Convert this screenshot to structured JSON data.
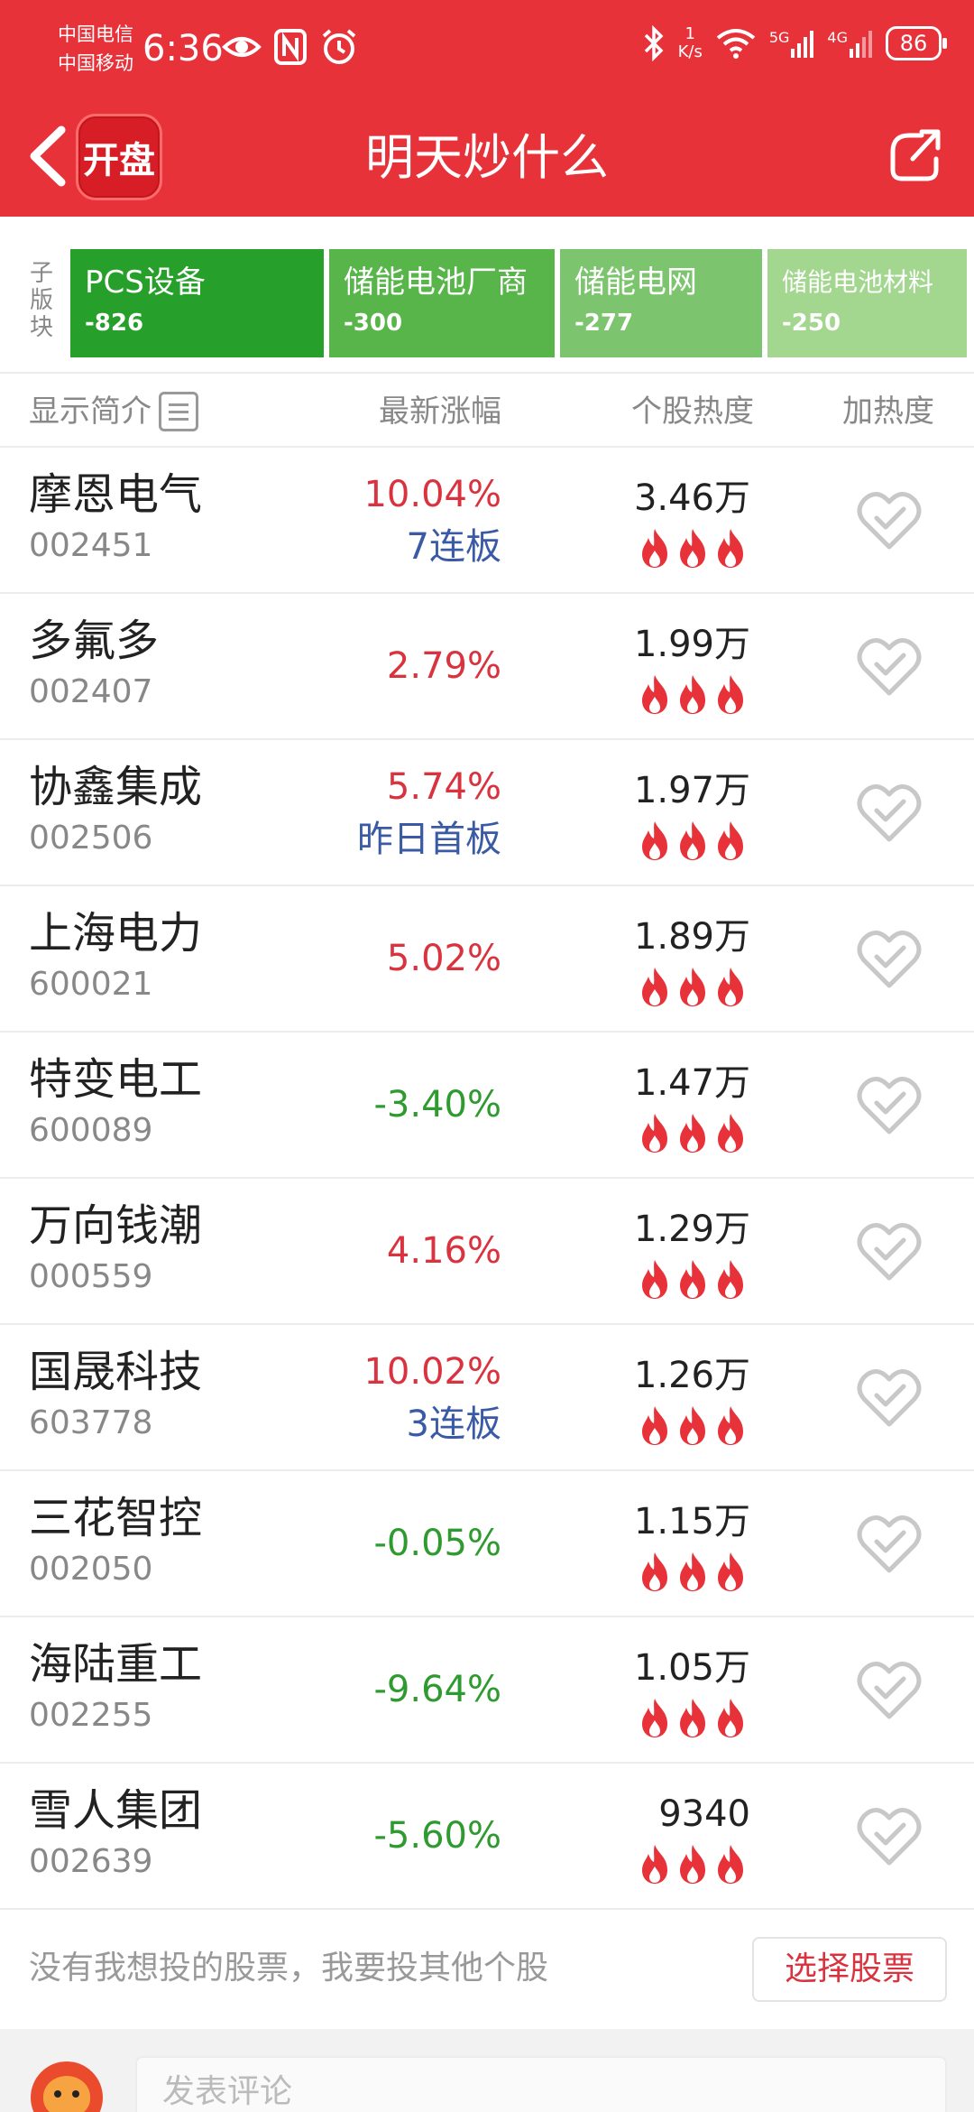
{
  "status_bar": {
    "carrier1": "中国电信",
    "carrier2": "中国移动",
    "time": "6:36",
    "net_speed_value": "1",
    "net_speed_unit": "K/s",
    "signal1_label": "5G",
    "signal2_label": "4G",
    "battery": "86",
    "icons_left": [
      "eye-icon",
      "nfc-icon",
      "alarm-icon"
    ],
    "icons_right": [
      "bluetooth-icon",
      "wifi-icon",
      "signal-icon",
      "signal-icon",
      "battery-icon"
    ]
  },
  "header": {
    "title": "明天炒什么",
    "logo_text": "开盘",
    "background_color": "#e8323a"
  },
  "sectors": {
    "label": "子版块",
    "tabs": [
      {
        "name": "PCS设备",
        "value": "-826",
        "color": "#26a02a"
      },
      {
        "name": "储能电池厂商",
        "value": "-300",
        "color": "#57b54a"
      },
      {
        "name": "储能电网",
        "value": "-277",
        "color": "#7cc46d"
      },
      {
        "name": "储能电池材料",
        "value": "-250",
        "color": "#a3d68f"
      }
    ]
  },
  "columns": {
    "intro": "显示简介",
    "change": "最新涨幅",
    "heat": "个股热度",
    "add": "加热度"
  },
  "stocks": [
    {
      "name": "摩恩电气",
      "code": "002451",
      "change": "10.04%",
      "dir": "up",
      "note": "7连板",
      "heat": "3.46万"
    },
    {
      "name": "多氟多",
      "code": "002407",
      "change": "2.79%",
      "dir": "up",
      "note": "",
      "heat": "1.99万"
    },
    {
      "name": "协鑫集成",
      "code": "002506",
      "change": "5.74%",
      "dir": "up",
      "note": "昨日首板",
      "heat": "1.97万"
    },
    {
      "name": "上海电力",
      "code": "600021",
      "change": "5.02%",
      "dir": "up",
      "note": "",
      "heat": "1.89万"
    },
    {
      "name": "特变电工",
      "code": "600089",
      "change": "-3.40%",
      "dir": "down",
      "note": "",
      "heat": "1.47万"
    },
    {
      "name": "万向钱潮",
      "code": "000559",
      "change": "4.16%",
      "dir": "up",
      "note": "",
      "heat": "1.29万"
    },
    {
      "name": "国晟科技",
      "code": "603778",
      "change": "10.02%",
      "dir": "up",
      "note": "3连板",
      "heat": "1.26万"
    },
    {
      "name": "三花智控",
      "code": "002050",
      "change": "-0.05%",
      "dir": "down",
      "note": "",
      "heat": "1.15万"
    },
    {
      "name": "海陆重工",
      "code": "002255",
      "change": "-9.64%",
      "dir": "down",
      "note": "",
      "heat": "1.05万"
    },
    {
      "name": "雪人集团",
      "code": "002639",
      "change": "-5.60%",
      "dir": "down",
      "note": "",
      "heat": "9340"
    }
  ],
  "flames_per_row": 3,
  "colors": {
    "up": "#d9333f",
    "down": "#2e9a2f",
    "note": "#3a5aa5",
    "flame": "#e8323a"
  },
  "footer": {
    "prompt": "没有我想投的股票，我要投其他个股",
    "choose_button": "选择股票",
    "comment_placeholder": "发表评论"
  }
}
